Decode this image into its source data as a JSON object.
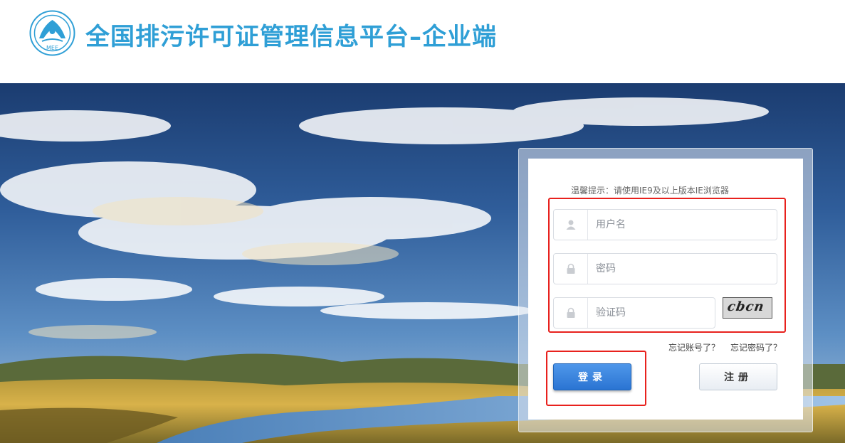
{
  "header": {
    "title": "全国排污许可证管理信息平台–企业端",
    "logo_text": "MEE"
  },
  "login": {
    "tip": "温馨提示：请使用IE9及以上版本IE浏览器",
    "username_placeholder": "用户名",
    "password_placeholder": "密码",
    "captcha_placeholder": "验证码",
    "captcha_code": "cbcn",
    "forgot_account": "忘记账号了？",
    "forgot_password": "忘记密码了？",
    "login_label": "登录",
    "register_label": "注册"
  },
  "colors": {
    "brand": "#2f9fd6",
    "login_button": "#2a74d2",
    "highlight": "#e8211d"
  }
}
